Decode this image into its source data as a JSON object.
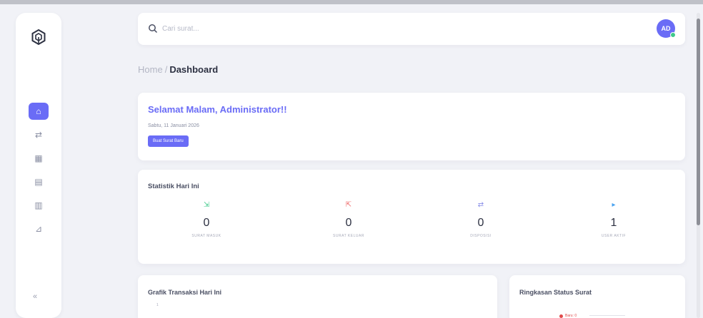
{
  "sidebar": {
    "logo": "hexagon-logo-icon",
    "items": [
      {
        "icon": "home-icon",
        "glyph": "⌂",
        "active": true
      },
      {
        "icon": "swap-arrows-icon",
        "glyph": "⇄",
        "active": false
      },
      {
        "icon": "calendar-icon",
        "glyph": "▦",
        "active": false
      },
      {
        "icon": "layers-icon",
        "glyph": "▤",
        "active": false
      },
      {
        "icon": "archive-icon",
        "glyph": "▥",
        "active": false
      },
      {
        "icon": "report-icon",
        "glyph": "⊿",
        "active": false
      }
    ],
    "collapse_glyph": "«"
  },
  "topbar": {
    "search_placeholder": "Cari surat...",
    "avatar_initials": "AD"
  },
  "breadcrumb": {
    "home": "Home",
    "separator": "/",
    "current": "Dashboard"
  },
  "welcome": {
    "title": "Selamat Malam, Administrator!!",
    "date": "Sabtu, 11 Januari 2026",
    "button_label": "Buat Surat Baru"
  },
  "stats": {
    "title": "Statistik Hari Ini",
    "items": [
      {
        "label": "SURAT MASUK",
        "value": "0",
        "color": "#3ec98a",
        "icon": "inbox-icon"
      },
      {
        "label": "SURAT KELUAR",
        "value": "0",
        "color": "#ef6b6b",
        "icon": "outbox-icon"
      },
      {
        "label": "DISPOSISI",
        "value": "0",
        "color": "#8a8fe8",
        "icon": "disposition-icon"
      },
      {
        "label": "USER AKTIF",
        "value": "1",
        "color": "#4aa3f0",
        "icon": "user-icon"
      }
    ]
  },
  "chart_card": {
    "title": "Grafik Transaksi Hari Ini",
    "tick": "1"
  },
  "summary_card": {
    "title": "Ringkasan Status Surat",
    "legend": "Baru: 0"
  },
  "colors": {
    "accent": "#6a6cf6",
    "background": "#f1f2f7"
  }
}
